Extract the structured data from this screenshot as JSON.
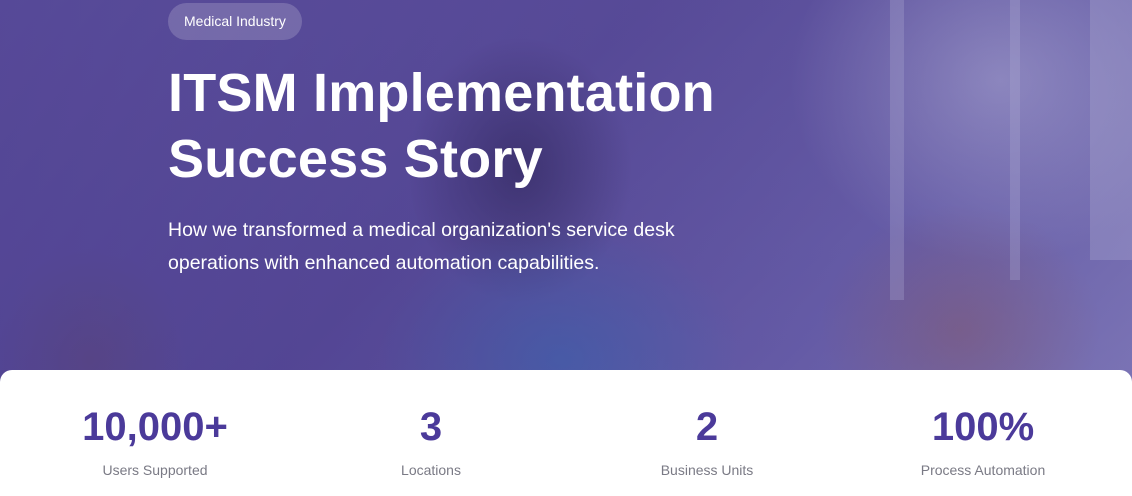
{
  "hero": {
    "badge": "Medical Industry",
    "title_line1": "ITSM Implementation",
    "title_line2": "Success Story",
    "subtitle_line1": "How we transformed a medical organization's service desk",
    "subtitle_line2": "operations with enhanced automation capabilities."
  },
  "stats": [
    {
      "value": "10,000+",
      "label": "Users Supported"
    },
    {
      "value": "3",
      "label": "Locations"
    },
    {
      "value": "2",
      "label": "Business Units"
    },
    {
      "value": "100%",
      "label": "Process Automation"
    }
  ],
  "colors": {
    "accent": "#4b3a9a",
    "label_gray": "#7a7a85",
    "hero_purple": "#5b4f98"
  }
}
